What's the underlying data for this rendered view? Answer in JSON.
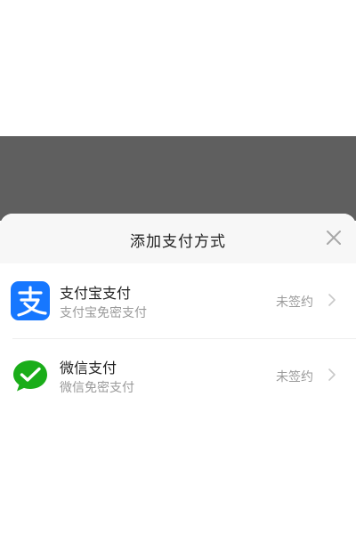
{
  "sheet": {
    "title": "添加支付方式",
    "close_icon": "close-icon"
  },
  "methods": [
    {
      "name": "支付宝支付",
      "description": "支付宝免密支付",
      "status": "未签约",
      "icon": "alipay-icon",
      "icon_color": "#1677ff"
    },
    {
      "name": "微信支付",
      "description": "微信免密支付",
      "status": "未签约",
      "icon": "wechat-pay-icon",
      "icon_color": "#1aad19"
    }
  ],
  "colors": {
    "overlay": "#5f5f5f",
    "header_bg": "#f7f7f7",
    "text_primary": "#222222",
    "text_secondary": "#9a9a9a"
  }
}
